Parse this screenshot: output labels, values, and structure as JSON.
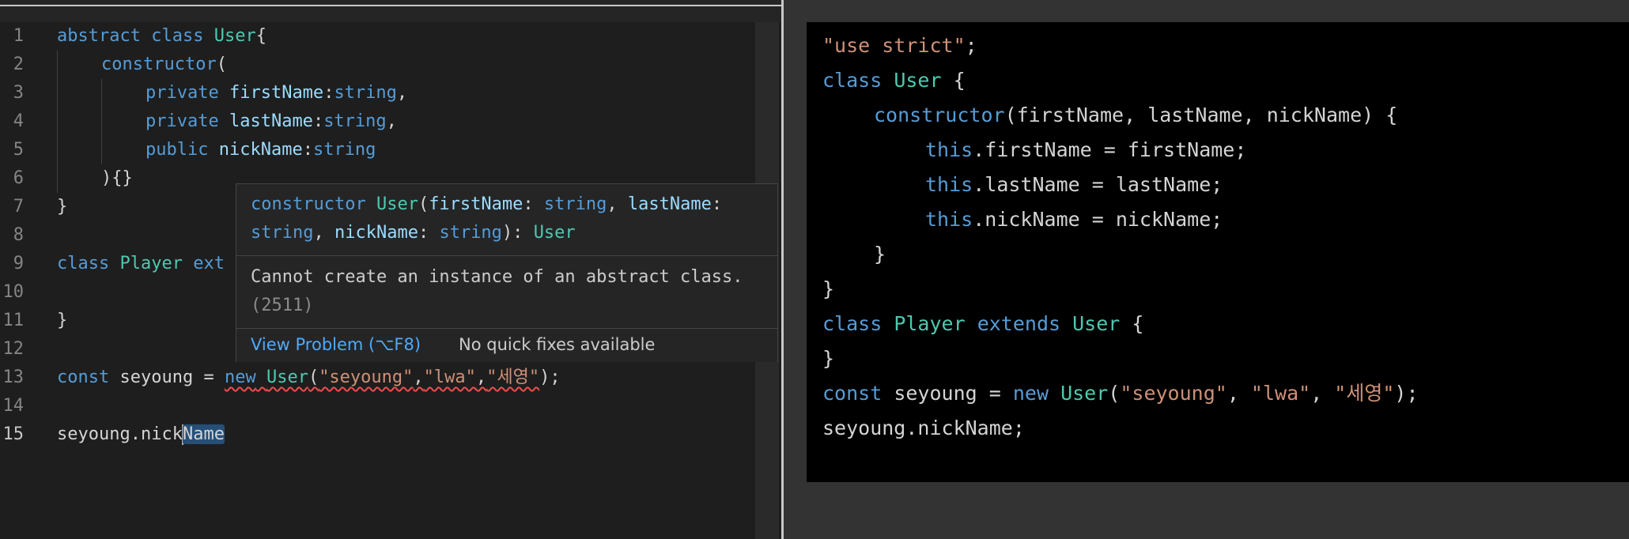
{
  "editor": {
    "line_numbers": [
      "1",
      "2",
      "3",
      "4",
      "5",
      "6",
      "7",
      "8",
      "9",
      "10",
      "11",
      "12",
      "13",
      "14",
      "15"
    ],
    "active_line": "15",
    "lines": {
      "l1": {
        "abstract": "abstract",
        "class": "class",
        "name": "User",
        "brace": "{"
      },
      "l2": {
        "constructor": "constructor",
        "paren": "("
      },
      "l3": {
        "mod": "private",
        "param": "firstName",
        "colon": ":",
        "type": "string",
        "comma": ","
      },
      "l4": {
        "mod": "private",
        "param": "lastName",
        "colon": ":",
        "type": "string",
        "comma": ","
      },
      "l5": {
        "mod": "public",
        "param": "nickName",
        "colon": ":",
        "type": "string"
      },
      "l6": {
        "text": "){}"
      },
      "l7": {
        "text": "}"
      },
      "l9": {
        "class": "class",
        "name": "Player",
        "rest": "ext"
      },
      "l11": {
        "text": "}"
      },
      "l13": {
        "const": "const",
        "var": "seyoung",
        "eq": " = ",
        "new": "new",
        "cls": "User",
        "open": "(",
        "s1": "\"seyoung\"",
        "c1": ",",
        "s2": "\"lwa\"",
        "c2": ",",
        "s3": "\"세영\"",
        "close": ");"
      },
      "l15": {
        "obj": "seyoung",
        "dot": ".",
        "prop_before": "nick",
        "prop_sel": "Name"
      }
    }
  },
  "hover": {
    "sig": {
      "keyword": "constructor",
      "cls": "User",
      "open": "(",
      "p1": "firstName",
      "colon1": ": ",
      "t1": "string",
      "comma1": ", ",
      "p2": "lastName",
      "colon2": ": ",
      "t2": "string",
      "comma2": ", ",
      "p3": "nickName",
      "colon3": ": ",
      "t3": "string",
      "close": "): ",
      "ret": "User"
    },
    "message": "Cannot create an instance of an abstract class.",
    "error_code": "(2511)",
    "view_problem": "View Problem (⌥F8)",
    "no_fixes": "No quick fixes available"
  },
  "output": {
    "o1": {
      "str": "\"use strict\"",
      "semi": ";"
    },
    "o2": {
      "class": "class",
      "name": "User",
      "brace": " {"
    },
    "o3": {
      "ctor": "constructor",
      "params": "(firstName, lastName, nickName) {"
    },
    "o4": {
      "this": "this",
      "rest": ".firstName = firstName;"
    },
    "o5": {
      "this": "this",
      "rest": ".lastName = lastName;"
    },
    "o6": {
      "this": "this",
      "rest": ".nickName = nickName;"
    },
    "o7": {
      "text": "}"
    },
    "o8": {
      "text": "}"
    },
    "o9": {
      "class": "class",
      "name": "Player",
      "extends": "extends",
      "base": "User",
      "brace": " {"
    },
    "o10": {
      "text": "}"
    },
    "o11": {
      "const": "const",
      "var": " seyoung = ",
      "new": "new",
      "cls": "User",
      "open": "(",
      "s1": "\"seyoung\"",
      "c1": ", ",
      "s2": "\"lwa\"",
      "c2": ", ",
      "s3": "\"세영\"",
      "close": ");"
    },
    "o12": {
      "text": "seyoung.nickName;"
    }
  },
  "colors": {
    "keyword": "#569cd6",
    "class": "#4ec9b0",
    "string": "#ce9178",
    "error": "#f14c4c",
    "link": "#4daafc"
  }
}
